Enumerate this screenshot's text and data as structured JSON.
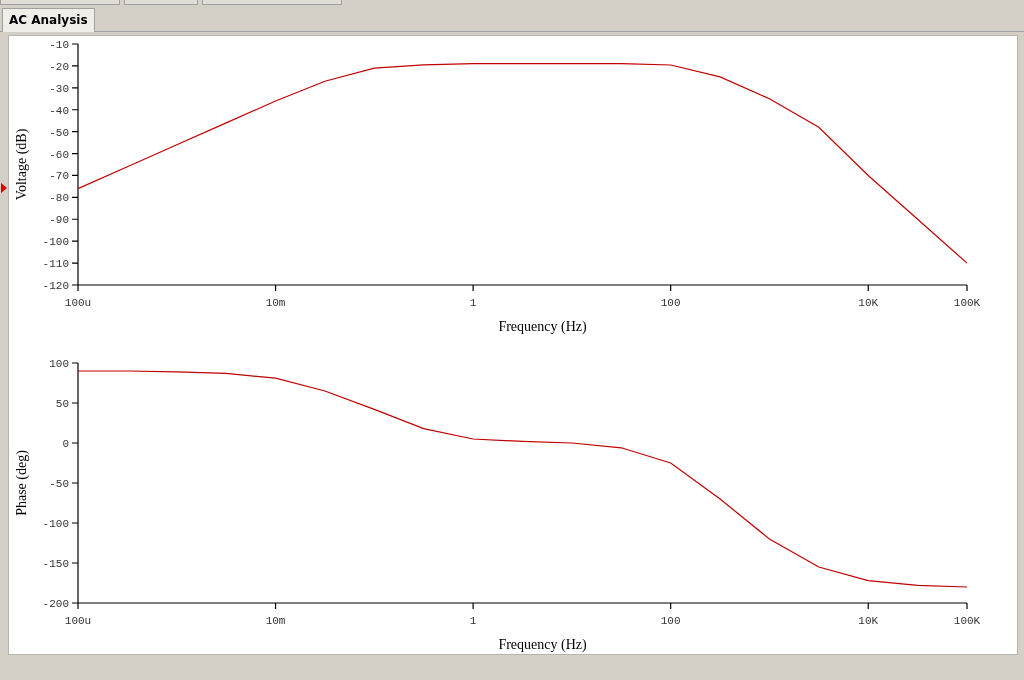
{
  "tabs": [
    {
      "label": "AC Analysis",
      "selected": true
    }
  ],
  "charts": [
    {
      "chart_data": {
        "type": "line",
        "xlabel": "Frequency (Hz)",
        "ylabel": "Voltage (dB)",
        "categories": [
          "100u",
          null,
          null,
          null,
          "10m",
          null,
          null,
          null,
          "1",
          null,
          null,
          null,
          "100",
          null,
          null,
          null,
          "10K",
          null,
          "100K"
        ],
        "series": [
          {
            "color": "#c00000",
            "values": [
              -76,
              -66,
              -56,
              -46,
              -36,
              -27,
              -21,
              -19.5,
              -19,
              -19,
              -19,
              -19,
              -19.6,
              -25,
              -35,
              -48,
              -70,
              -90,
              -110
            ]
          }
        ],
        "ylim": [
          -120,
          -10
        ],
        "yticks": [
          -10,
          -20,
          -30,
          -40,
          -50,
          -60,
          -70,
          -80,
          -90,
          -100,
          -110,
          -120
        ]
      }
    },
    {
      "chart_data": {
        "type": "line",
        "xlabel": "Frequency (Hz)",
        "ylabel": "Phase (deg)",
        "categories": [
          "100u",
          null,
          null,
          null,
          "10m",
          null,
          null,
          null,
          "1",
          null,
          null,
          null,
          "100",
          null,
          null,
          null,
          "10K",
          null,
          "100K"
        ],
        "series": [
          {
            "color": "#c00000",
            "values": [
              90,
              90,
              89,
              87,
              81,
              65,
              42,
              18,
              5,
              2,
              0,
              -6,
              -25,
              -70,
              -120,
              -155,
              -172,
              -178,
              -180
            ]
          }
        ],
        "ylim": [
          -200,
          100
        ],
        "yticks": [
          100,
          50,
          0,
          -50,
          -100,
          -150,
          -200
        ]
      }
    }
  ]
}
